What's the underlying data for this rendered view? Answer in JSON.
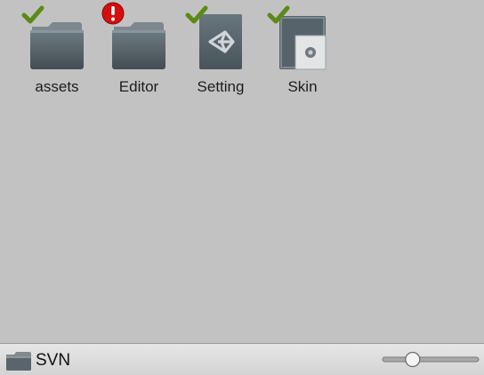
{
  "assets": [
    {
      "label": "assets",
      "icon": "folder-icon",
      "status": "ok"
    },
    {
      "label": "Editor",
      "icon": "folder-icon",
      "status": "error"
    },
    {
      "label": "Setting",
      "icon": "unity-asset-icon",
      "status": "ok"
    },
    {
      "label": "Skin",
      "icon": "gui-skin-icon",
      "status": "ok"
    }
  ],
  "statusbar": {
    "path_label": "SVN",
    "path_icon": "folder-icon",
    "zoom_fraction": 0.28
  },
  "colors": {
    "background": "#c2c2c2",
    "ok_check": "#5a8a17",
    "error_badge": "#d40f0f",
    "folder_body": "#4e5a61"
  }
}
